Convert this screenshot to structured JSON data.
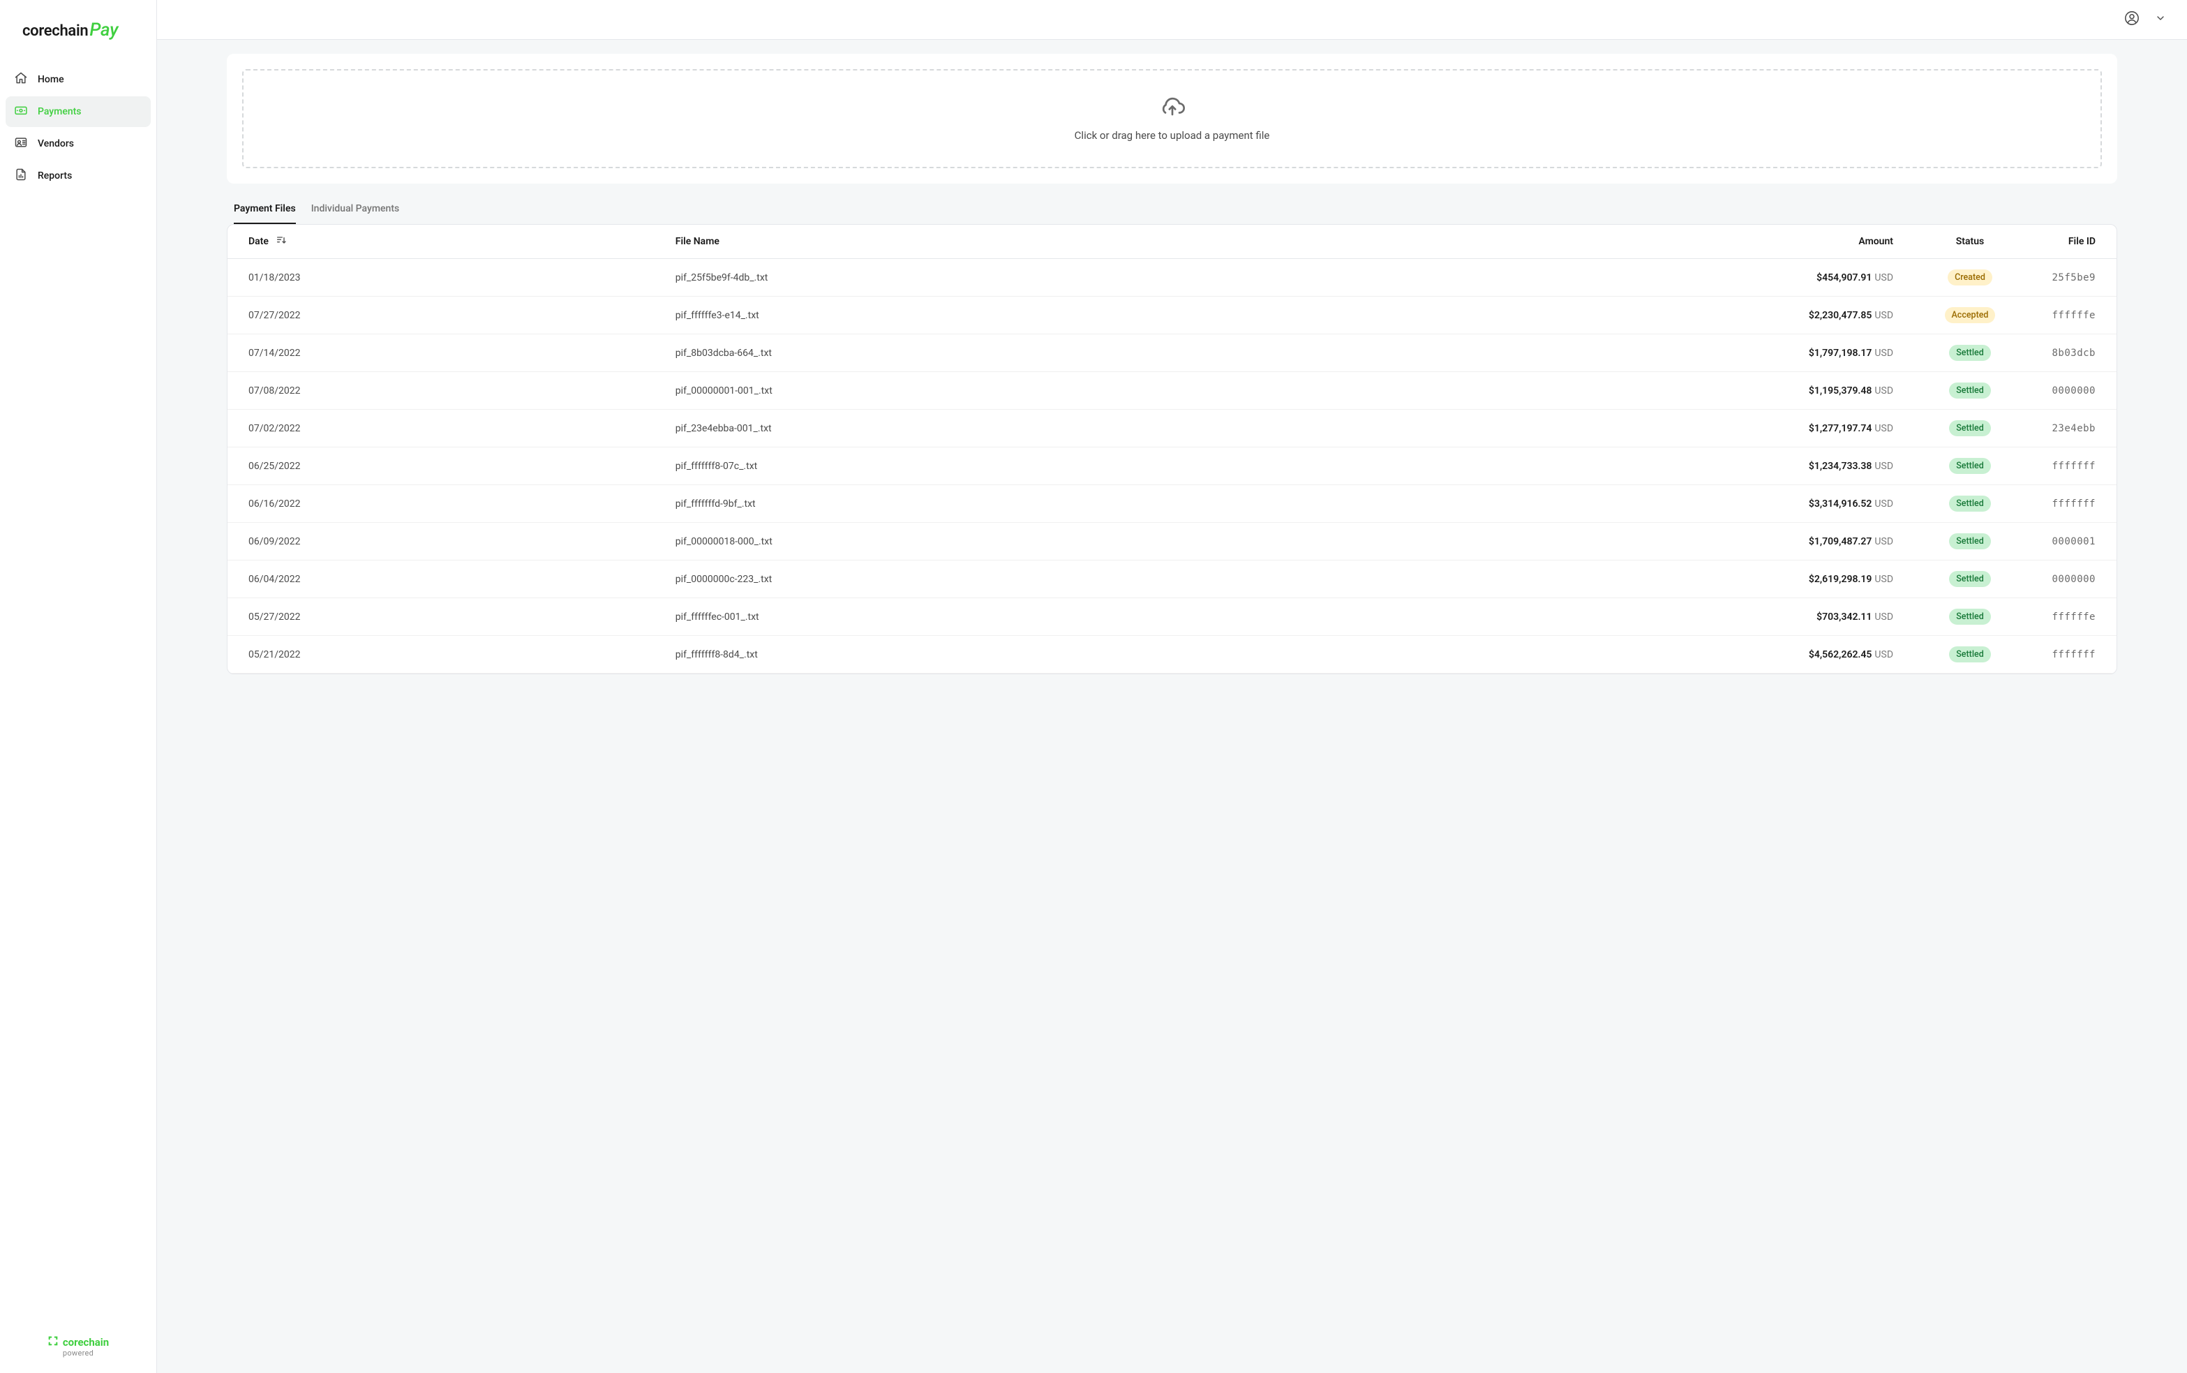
{
  "brand": {
    "part1": "corechain",
    "part2": "Pay"
  },
  "sidebar": {
    "items": [
      {
        "label": "Home",
        "icon": "home-icon",
        "active": false
      },
      {
        "label": "Payments",
        "icon": "payments-icon",
        "active": true
      },
      {
        "label": "Vendors",
        "icon": "vendors-icon",
        "active": false
      },
      {
        "label": "Reports",
        "icon": "reports-icon",
        "active": false
      }
    ],
    "footer": {
      "line1": "corechain",
      "line2": "powered"
    }
  },
  "upload": {
    "prompt": "Click or drag here to upload a payment file"
  },
  "tabs": [
    {
      "label": "Payment Files",
      "active": true
    },
    {
      "label": "Individual Payments",
      "active": false
    }
  ],
  "table": {
    "columns": {
      "date": "Date",
      "fileName": "File Name",
      "amount": "Amount",
      "status": "Status",
      "fileId": "File ID"
    },
    "rows": [
      {
        "date": "01/18/2023",
        "fileName": "pif_25f5be9f-4db_.txt",
        "amount": "$454,907.91",
        "currency": "USD",
        "status": "Created",
        "fileId": "25f5be9"
      },
      {
        "date": "07/27/2022",
        "fileName": "pif_ffffffe3-e14_.txt",
        "amount": "$2,230,477.85",
        "currency": "USD",
        "status": "Accepted",
        "fileId": "ffffffe"
      },
      {
        "date": "07/14/2022",
        "fileName": "pif_8b03dcba-664_.txt",
        "amount": "$1,797,198.17",
        "currency": "USD",
        "status": "Settled",
        "fileId": "8b03dcb"
      },
      {
        "date": "07/08/2022",
        "fileName": "pif_00000001-001_.txt",
        "amount": "$1,195,379.48",
        "currency": "USD",
        "status": "Settled",
        "fileId": "0000000"
      },
      {
        "date": "07/02/2022",
        "fileName": "pif_23e4ebba-001_.txt",
        "amount": "$1,277,197.74",
        "currency": "USD",
        "status": "Settled",
        "fileId": "23e4ebb"
      },
      {
        "date": "06/25/2022",
        "fileName": "pif_fffffff8-07c_.txt",
        "amount": "$1,234,733.38",
        "currency": "USD",
        "status": "Settled",
        "fileId": "fffffff"
      },
      {
        "date": "06/16/2022",
        "fileName": "pif_fffffffd-9bf_.txt",
        "amount": "$3,314,916.52",
        "currency": "USD",
        "status": "Settled",
        "fileId": "fffffff"
      },
      {
        "date": "06/09/2022",
        "fileName": "pif_00000018-000_.txt",
        "amount": "$1,709,487.27",
        "currency": "USD",
        "status": "Settled",
        "fileId": "0000001"
      },
      {
        "date": "06/04/2022",
        "fileName": "pif_0000000c-223_.txt",
        "amount": "$2,619,298.19",
        "currency": "USD",
        "status": "Settled",
        "fileId": "0000000"
      },
      {
        "date": "05/27/2022",
        "fileName": "pif_ffffffec-001_.txt",
        "amount": "$703,342.11",
        "currency": "USD",
        "status": "Settled",
        "fileId": "ffffffe"
      },
      {
        "date": "05/21/2022",
        "fileName": "pif_fffffff8-8d4_.txt",
        "amount": "$4,562,262.45",
        "currency": "USD",
        "status": "Settled",
        "fileId": "fffffff"
      }
    ]
  }
}
